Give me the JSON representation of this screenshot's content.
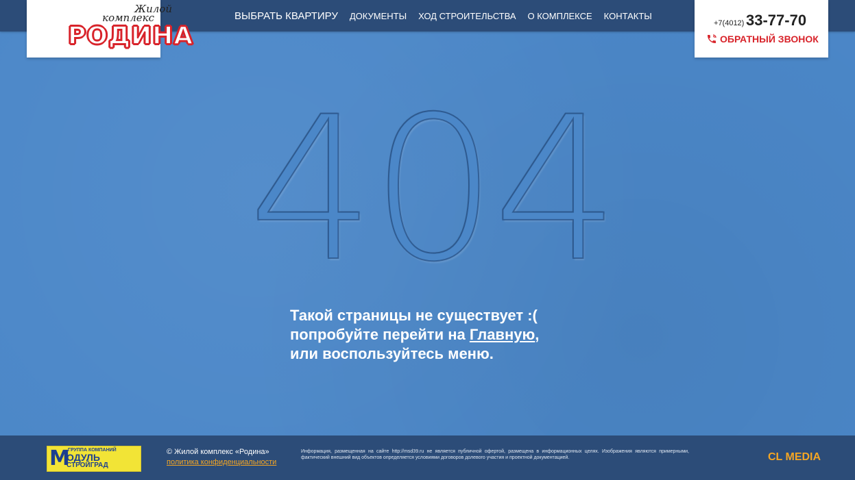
{
  "header": {
    "logo": {
      "script_line1": "Жилой",
      "script_line2": "комплекс",
      "main": "РОДИНА"
    },
    "nav": [
      "Выбрать квартиру",
      "Документы",
      "Ход строительства",
      "О комплексе",
      "Контакты"
    ],
    "phone_code": "+7(4012)",
    "phone_number": "33-77-70",
    "callback_label": "ОБРАТНЫЙ ЗВОНОК"
  },
  "main": {
    "error_code": "404",
    "message_line1": "Такой страницы не существует :(",
    "message_line2_prefix": "попробуйте перейти на ",
    "message_line2_link": "Главную",
    "message_line2_suffix": ",",
    "message_line3": "или воспользуйтесь меню."
  },
  "footer": {
    "partner_logo": {
      "top": "ГРУППА КОМПАНИЙ",
      "middle": "ОДУЛЬ",
      "letter": "М",
      "bottom": "СТРОЙГРАД"
    },
    "copyright": "© Жилой комплекс «Родина»",
    "policy_link": "политика конфиденциальности",
    "disclaimer": "Информация, размещенная на сайте http://msd39.ru не является публичной офертой, размещена в информационных целях. Изображения являются примерными, фактический внешний вид объектов определяется условиями договоров долевого участия и проектной документацией.",
    "developer": "CL MEDIA"
  },
  "colors": {
    "background": "#4b87c8",
    "bar": "#2c4c78",
    "accent_red": "#d8232a",
    "accent_orange": "#f5a623"
  },
  "icons": [
    "phone-icon"
  ]
}
